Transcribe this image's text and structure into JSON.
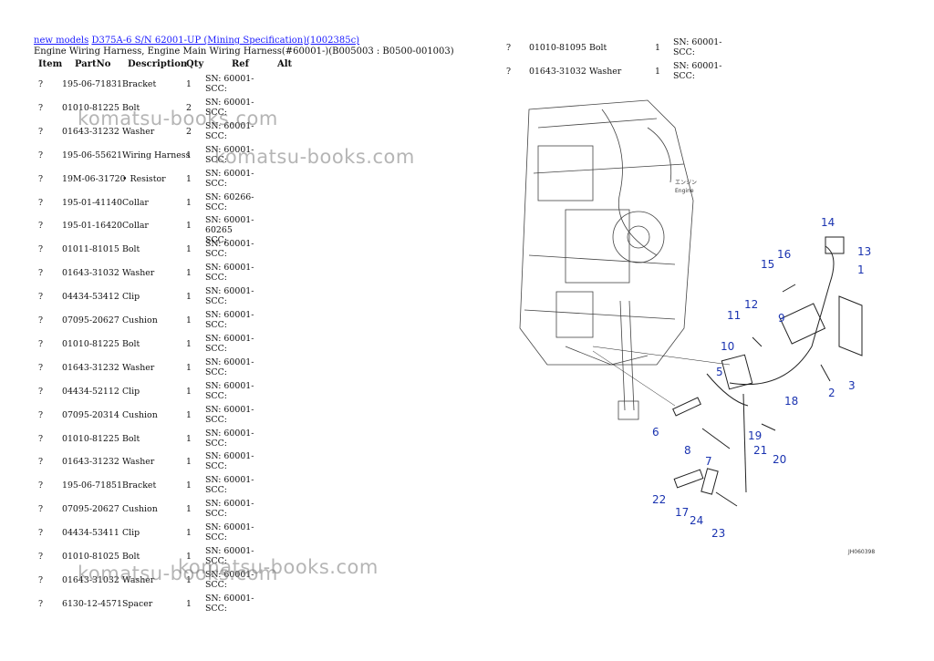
{
  "breadcrumb": {
    "link1": "new models",
    "link2": "D375A-6 S/N 62001-UP (Mining Specification)(1002385c)"
  },
  "subtitle": "Engine Wiring Harness, Engine Main Wiring Harness(#60001-)(B005003 : B0500-001003)",
  "columns": {
    "item": "Item",
    "part": "PartNo",
    "desc": "Description",
    "qty": "Qty",
    "ref": "Ref",
    "alt": "Alt"
  },
  "left_rows": [
    {
      "item": "?",
      "part": "195-06-71831",
      "desc": "Bracket",
      "qty": "1",
      "ref": "SN: 60001-\nSCC:"
    },
    {
      "item": "?",
      "part": "01010-81225",
      "desc": "Bolt",
      "qty": "2",
      "ref": "SN: 60001-\nSCC:"
    },
    {
      "item": "?",
      "part": "01643-31232",
      "desc": "Washer",
      "qty": "2",
      "ref": "SN: 60001-\nSCC:"
    },
    {
      "item": "?",
      "part": "195-06-55621",
      "desc": "Wiring Harness",
      "qty": "1",
      "ref": "SN: 60001-\nSCC:"
    },
    {
      "item": "?",
      "part": "19M-06-31720",
      "desc": "• Resistor",
      "qty": "1",
      "ref": "SN: 60001-\nSCC:"
    },
    {
      "item": "?",
      "part": "195-01-41140",
      "desc": "Collar",
      "qty": "1",
      "ref": "SN: 60266-\nSCC:"
    },
    {
      "item": "?",
      "part": "195-01-16420",
      "desc": "Collar",
      "qty": "1",
      "ref": "SN: 60001-60265\nSCC:"
    },
    {
      "item": "?",
      "part": "01011-81015",
      "desc": "Bolt",
      "qty": "1",
      "ref": "SN: 60001-\nSCC:"
    },
    {
      "item": "?",
      "part": "01643-31032",
      "desc": "Washer",
      "qty": "1",
      "ref": "SN: 60001-\nSCC:"
    },
    {
      "item": "?",
      "part": "04434-53412",
      "desc": "Clip",
      "qty": "1",
      "ref": "SN: 60001-\nSCC:"
    },
    {
      "item": "?",
      "part": "07095-20627",
      "desc": "Cushion",
      "qty": "1",
      "ref": "SN: 60001-\nSCC:"
    },
    {
      "item": "?",
      "part": "01010-81225",
      "desc": "Bolt",
      "qty": "1",
      "ref": "SN: 60001-\nSCC:"
    },
    {
      "item": "?",
      "part": "01643-31232",
      "desc": "Washer",
      "qty": "1",
      "ref": "SN: 60001-\nSCC:"
    },
    {
      "item": "?",
      "part": "04434-52112",
      "desc": "Clip",
      "qty": "1",
      "ref": "SN: 60001-\nSCC:"
    },
    {
      "item": "?",
      "part": "07095-20314",
      "desc": "Cushion",
      "qty": "1",
      "ref": "SN: 60001-\nSCC:"
    },
    {
      "item": "?",
      "part": "01010-81225",
      "desc": "Bolt",
      "qty": "1",
      "ref": "SN: 60001-\nSCC:"
    },
    {
      "item": "?",
      "part": "01643-31232",
      "desc": "Washer",
      "qty": "1",
      "ref": "SN: 60001-\nSCC:"
    },
    {
      "item": "?",
      "part": "195-06-71851",
      "desc": "Bracket",
      "qty": "1",
      "ref": "SN: 60001-\nSCC:"
    },
    {
      "item": "?",
      "part": "07095-20627",
      "desc": "Cushion",
      "qty": "1",
      "ref": "SN: 60001-\nSCC:"
    },
    {
      "item": "?",
      "part": "04434-53411",
      "desc": "Clip",
      "qty": "1",
      "ref": "SN: 60001-\nSCC:"
    },
    {
      "item": "?",
      "part": "01010-81025",
      "desc": "Bolt",
      "qty": "1",
      "ref": "SN: 60001-\nSCC:"
    },
    {
      "item": "?",
      "part": "01643-31032",
      "desc": "Washer",
      "qty": "1",
      "ref": "SN: 60001-\nSCC:"
    },
    {
      "item": "?",
      "part": "6130-12-4571",
      "desc": "Spacer",
      "qty": "1",
      "ref": "SN: 60001-\nSCC:"
    }
  ],
  "right_rows": [
    {
      "item": "?",
      "part": "01010-81095",
      "desc": "Bolt",
      "qty": "1",
      "ref": "SN: 60001-\nSCC:"
    },
    {
      "item": "?",
      "part": "01643-31032",
      "desc": "Washer",
      "qty": "1",
      "ref": "SN: 60001-\nSCC:"
    }
  ],
  "watermark": "komatsu-books.com",
  "diagram": {
    "engine_label_jp": "エンジン",
    "engine_label_en": "Engine",
    "figure_code": "JH060398",
    "callouts": [
      "1",
      "2",
      "3",
      "5",
      "6",
      "7",
      "8",
      "9",
      "10",
      "11",
      "12",
      "13",
      "14",
      "15",
      "16",
      "17",
      "18",
      "19",
      "20",
      "21",
      "22",
      "23",
      "24"
    ]
  },
  "colors": {
    "link": "#1a1aff",
    "callout": "#1a33b0"
  }
}
